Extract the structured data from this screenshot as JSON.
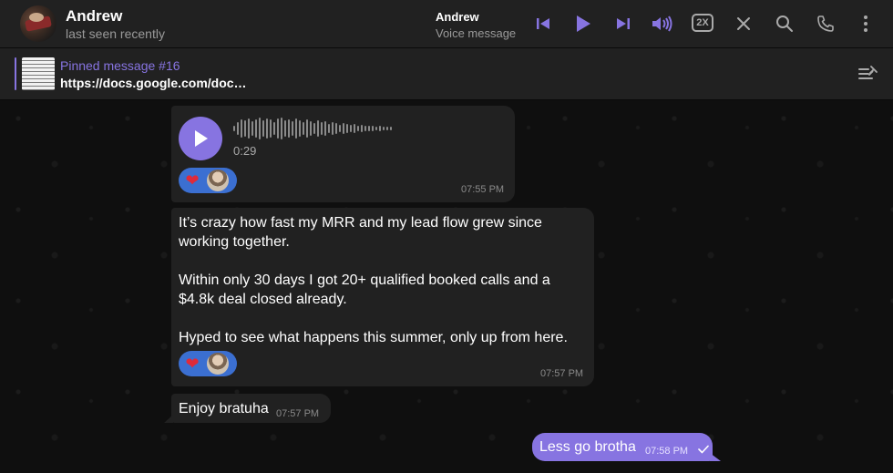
{
  "header": {
    "contact_name": "Andrew",
    "contact_status": "last seen recently",
    "player_title": "Andrew",
    "player_subtitle": "Voice message",
    "speed_label": "2X",
    "icons": [
      "skip-previous-icon",
      "play-icon",
      "skip-next-icon",
      "volume-icon",
      "speed-icon",
      "close-icon",
      "search-icon",
      "phone-icon",
      "more-vertical-icon"
    ]
  },
  "pinned": {
    "title": "Pinned message #16",
    "text": "https://docs.google.com/doc…"
  },
  "messages": {
    "voice": {
      "duration": "0:29",
      "reaction_emoji": "❤",
      "time": "07:55 PM"
    },
    "long_text": {
      "lines": [
        "It’s crazy how fast my MRR and my lead flow grew since",
        "working together.",
        "Within only 30 days I got 20+ qualified booked calls and a",
        "$4.8k deal closed already.",
        "Hyped to see what happens this summer, only up from here."
      ],
      "reaction_emoji": "❤",
      "time": "07:57 PM"
    },
    "short": {
      "text": "Enjoy bratuha",
      "time": "07:57 PM"
    },
    "outgoing": {
      "text": "Less go brotha",
      "time": "07:58 PM"
    }
  },
  "colors": {
    "accent": "#8774e1",
    "bubble_in": "#212121",
    "reaction_bg": "#3b6fd1",
    "header_bg": "#212121"
  }
}
